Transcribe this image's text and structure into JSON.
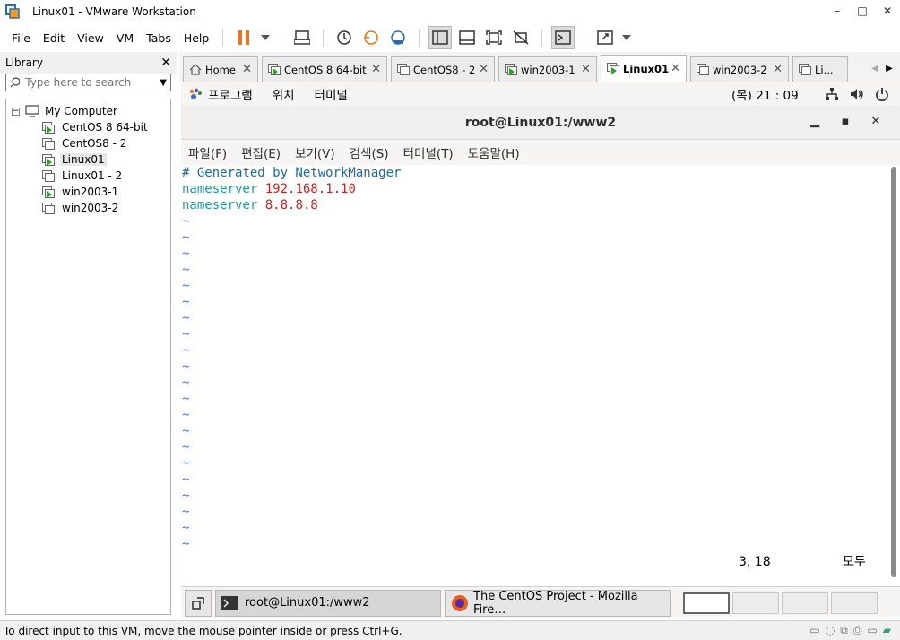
{
  "window": {
    "title": "Linux01 - VMware Workstation",
    "min": "–",
    "max": "□",
    "close": "✕"
  },
  "menu": [
    "File",
    "Edit",
    "View",
    "VM",
    "Tabs",
    "Help"
  ],
  "library": {
    "title": "Library",
    "search_placeholder": "Type here to search",
    "root": "My Computer",
    "items": [
      {
        "label": "CentOS 8 64-bit",
        "running": true
      },
      {
        "label": "CentOS8 - 2",
        "running": false
      },
      {
        "label": "Linux01",
        "running": true,
        "selected": true
      },
      {
        "label": "Linux01 - 2",
        "running": false
      },
      {
        "label": "win2003-1",
        "running": true
      },
      {
        "label": "win2003-2",
        "running": false
      }
    ]
  },
  "tabs": [
    {
      "label": "Home",
      "icon": "home-icon"
    },
    {
      "label": "CentOS 8 64-bit",
      "icon": "vm-running-icon"
    },
    {
      "label": "CentOS8 - 2",
      "icon": "vm-icon"
    },
    {
      "label": "win2003-1",
      "icon": "vm-running-icon"
    },
    {
      "label": "Linux01",
      "icon": "vm-running-icon",
      "active": true
    },
    {
      "label": "win2003-2",
      "icon": "vm-icon"
    },
    {
      "label": "Li...",
      "icon": "vm-icon"
    }
  ],
  "gnome": {
    "menus": [
      "프로그램",
      "위치",
      "터미널"
    ],
    "clock": "(목) 21 : 09"
  },
  "terminal": {
    "title": "root@Linux01:/www2",
    "menus": [
      "파일(F)",
      "편집(E)",
      "보기(V)",
      "검색(S)",
      "터미널(T)",
      "도움말(H)"
    ],
    "line1": "# Generated by NetworkManager",
    "line2_kw": "nameserver",
    "line2_val": "192.168.1.10",
    "line3_kw": "nameserver",
    "line3_val": "8.8.8.8",
    "tilde": "~",
    "cursor_pos": "3, 18",
    "view_all": "모두"
  },
  "taskbar": {
    "items": [
      "root@Linux01:/www2",
      "The CentOS Project - Mozilla Fire…"
    ]
  },
  "statusbar": {
    "text": "To direct input to this VM, move the mouse pointer inside or press Ctrl+G."
  }
}
